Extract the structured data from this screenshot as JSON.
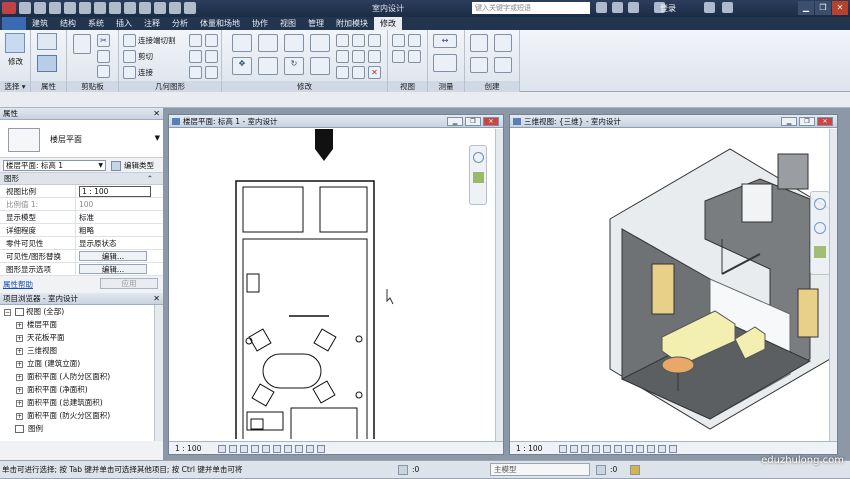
{
  "titlebar": {
    "title": "室内设计",
    "search_placeholder": "键入关键字或短语",
    "login": "登录"
  },
  "tabs": [
    "建筑",
    "结构",
    "系统",
    "插入",
    "注释",
    "分析",
    "体量和场地",
    "协作",
    "视图",
    "管理",
    "附加模块",
    "修改"
  ],
  "ribbon": {
    "modify_label": "修改",
    "panels": [
      "选择 ▾",
      "属性",
      "剪贴板",
      "几何图形",
      "修改",
      "视图",
      "测量",
      "创建"
    ],
    "geometry": {
      "cope": "连接端切割",
      "cut": "剪切",
      "join": "连接"
    }
  },
  "properties": {
    "header": "属性",
    "type_name": "楼层平面",
    "instance": "楼层平面: 标高 1",
    "edit_type": "编辑类型",
    "section": "图形",
    "rows": [
      {
        "k": "视图比例",
        "v": "1 : 100"
      },
      {
        "k": "比例值 1:",
        "v": "100"
      },
      {
        "k": "显示模型",
        "v": "标准"
      },
      {
        "k": "详细程度",
        "v": "粗略"
      },
      {
        "k": "零件可见性",
        "v": "显示原状态"
      },
      {
        "k": "可见性/图形替换",
        "v": "编辑..."
      },
      {
        "k": "图形显示选项",
        "v": "编辑..."
      }
    ],
    "help": "属性帮助",
    "apply": "应用"
  },
  "browser": {
    "header": "项目浏览器 - 室内设计",
    "items": [
      {
        "label": "视图 (全部)",
        "level": 0,
        "sign": "−"
      },
      {
        "label": "楼层平面",
        "level": 1,
        "sign": "+"
      },
      {
        "label": "天花板平面",
        "level": 1,
        "sign": "+"
      },
      {
        "label": "三维视图",
        "level": 1,
        "sign": "+"
      },
      {
        "label": "立面 (建筑立面)",
        "level": 1,
        "sign": "+"
      },
      {
        "label": "面积平面 (人防分区面积)",
        "level": 1,
        "sign": "+"
      },
      {
        "label": "面积平面 (净面积)",
        "level": 1,
        "sign": "+"
      },
      {
        "label": "面积平面 (总建筑面积)",
        "level": 1,
        "sign": "+"
      },
      {
        "label": "面积平面 (防火分区面积)",
        "level": 1,
        "sign": "+"
      },
      {
        "label": "图例",
        "level": 0,
        "sign": ""
      }
    ]
  },
  "views": {
    "plan": {
      "title": "楼层平面: 标高 1 - 室内设计",
      "scale": "1 : 100"
    },
    "threed": {
      "title": "三维视图: {三维} - 室内设计",
      "scale": "1 : 100"
    }
  },
  "status": {
    "hint": "单击可进行选择; 按 Tab 键并单击可选择其他项目; 按 Ctrl 键并单击可将",
    "zero1": ":0",
    "model": "主模型",
    "zero2": ":0"
  },
  "watermark": "eduzhulong.com"
}
